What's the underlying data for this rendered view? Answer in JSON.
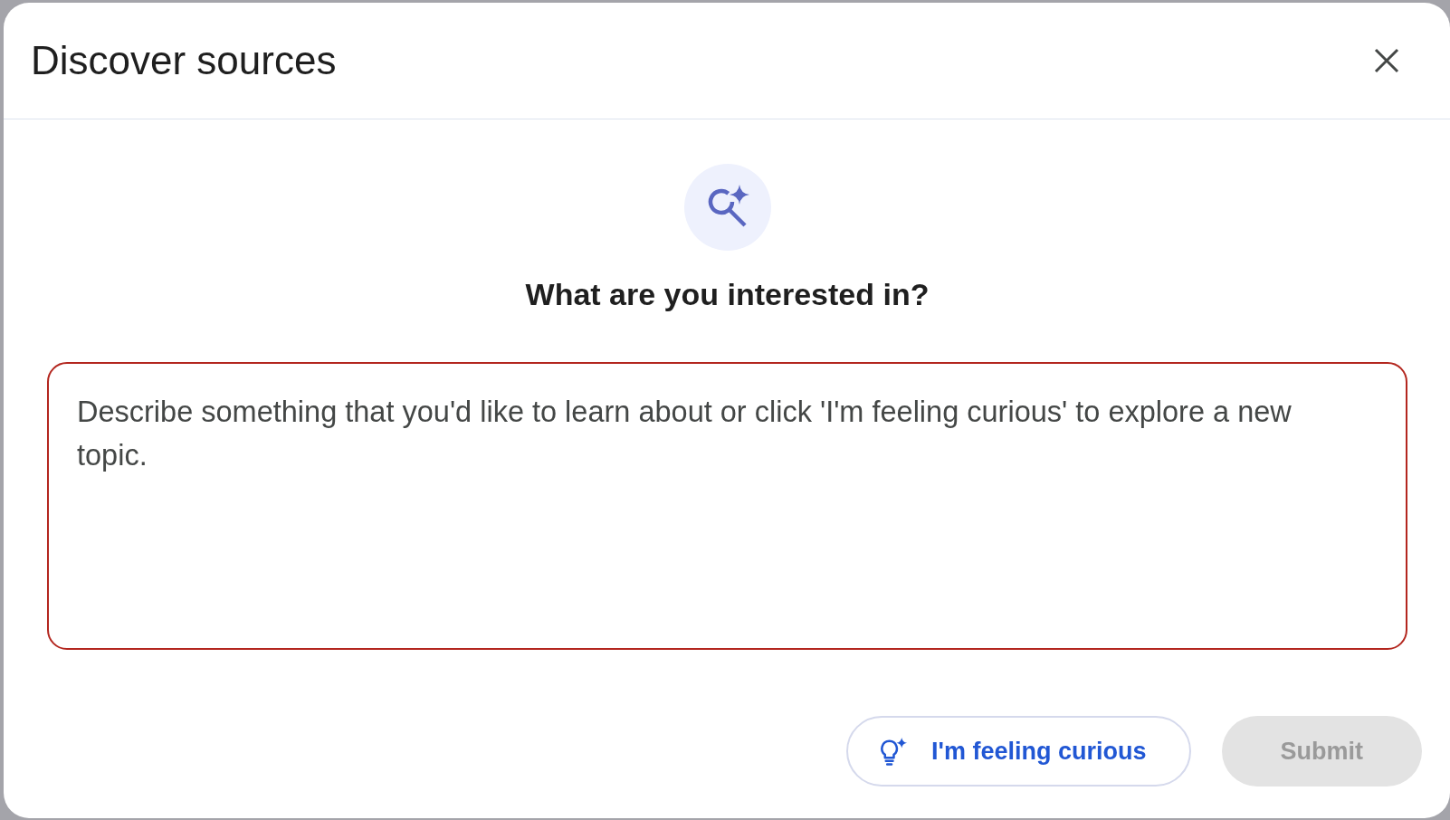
{
  "dialog": {
    "title": "Discover sources"
  },
  "prompt": {
    "heading": "What are you interested in?"
  },
  "query_field": {
    "placeholder": "Describe something that you'd like to learn about or click 'I'm feeling curious' to explore a new topic."
  },
  "buttons": [
    {
      "kind": "outlined",
      "label": "I'm feeling curious",
      "disabled": false
    },
    {
      "kind": "filled",
      "label": "Submit",
      "disabled": true
    }
  ]
}
